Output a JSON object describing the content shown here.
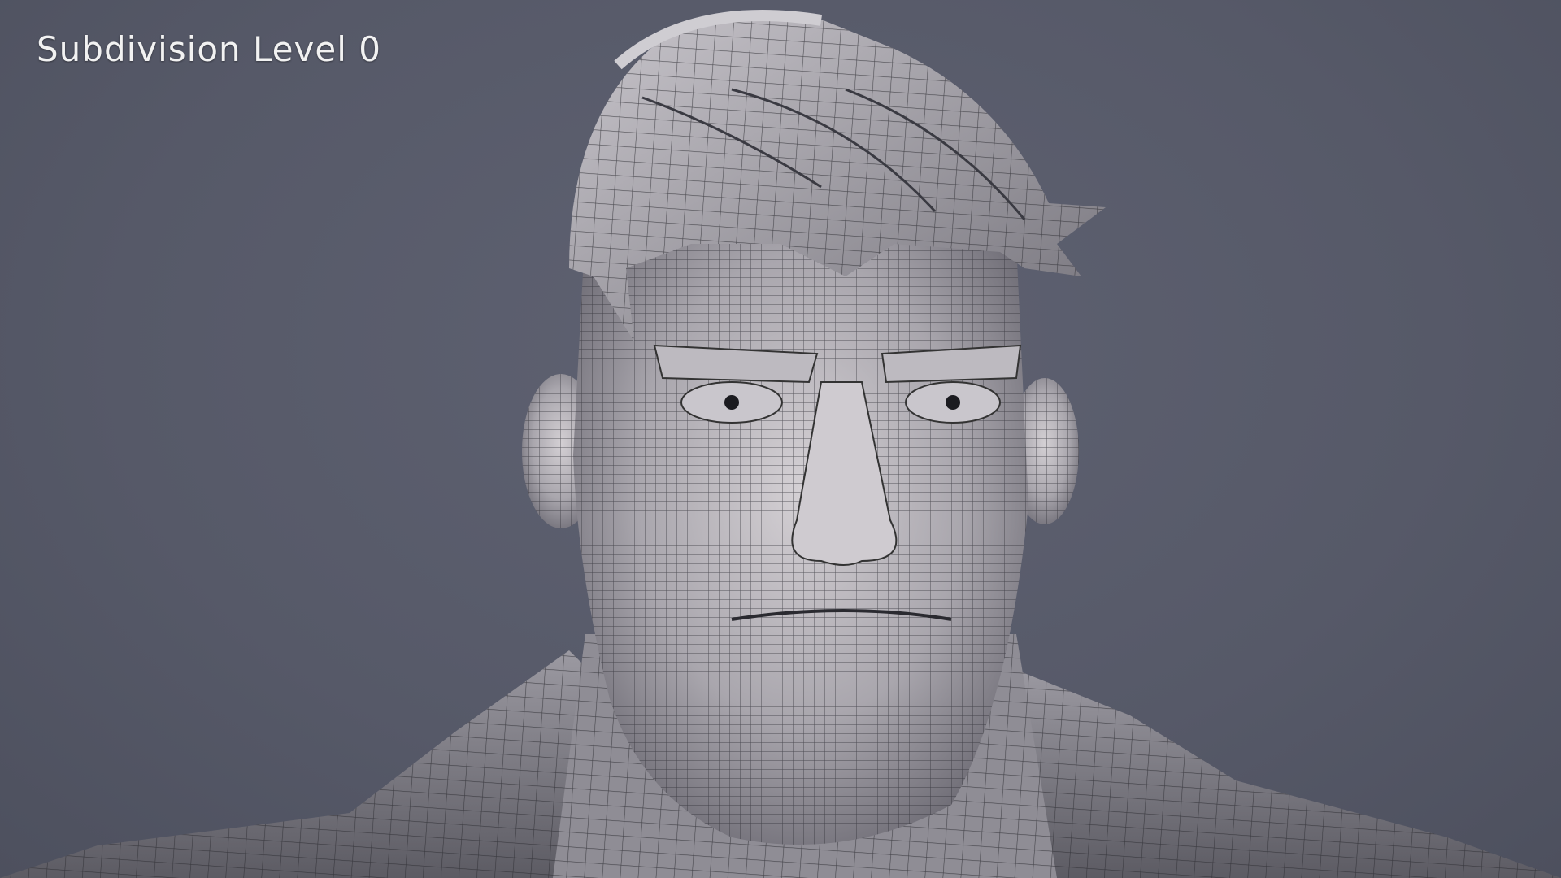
{
  "caption": "Subdivision Level 0",
  "colors": {
    "background": "#565968",
    "mesh_surface": "#b9b7bd",
    "wire": "#2a2a30"
  }
}
